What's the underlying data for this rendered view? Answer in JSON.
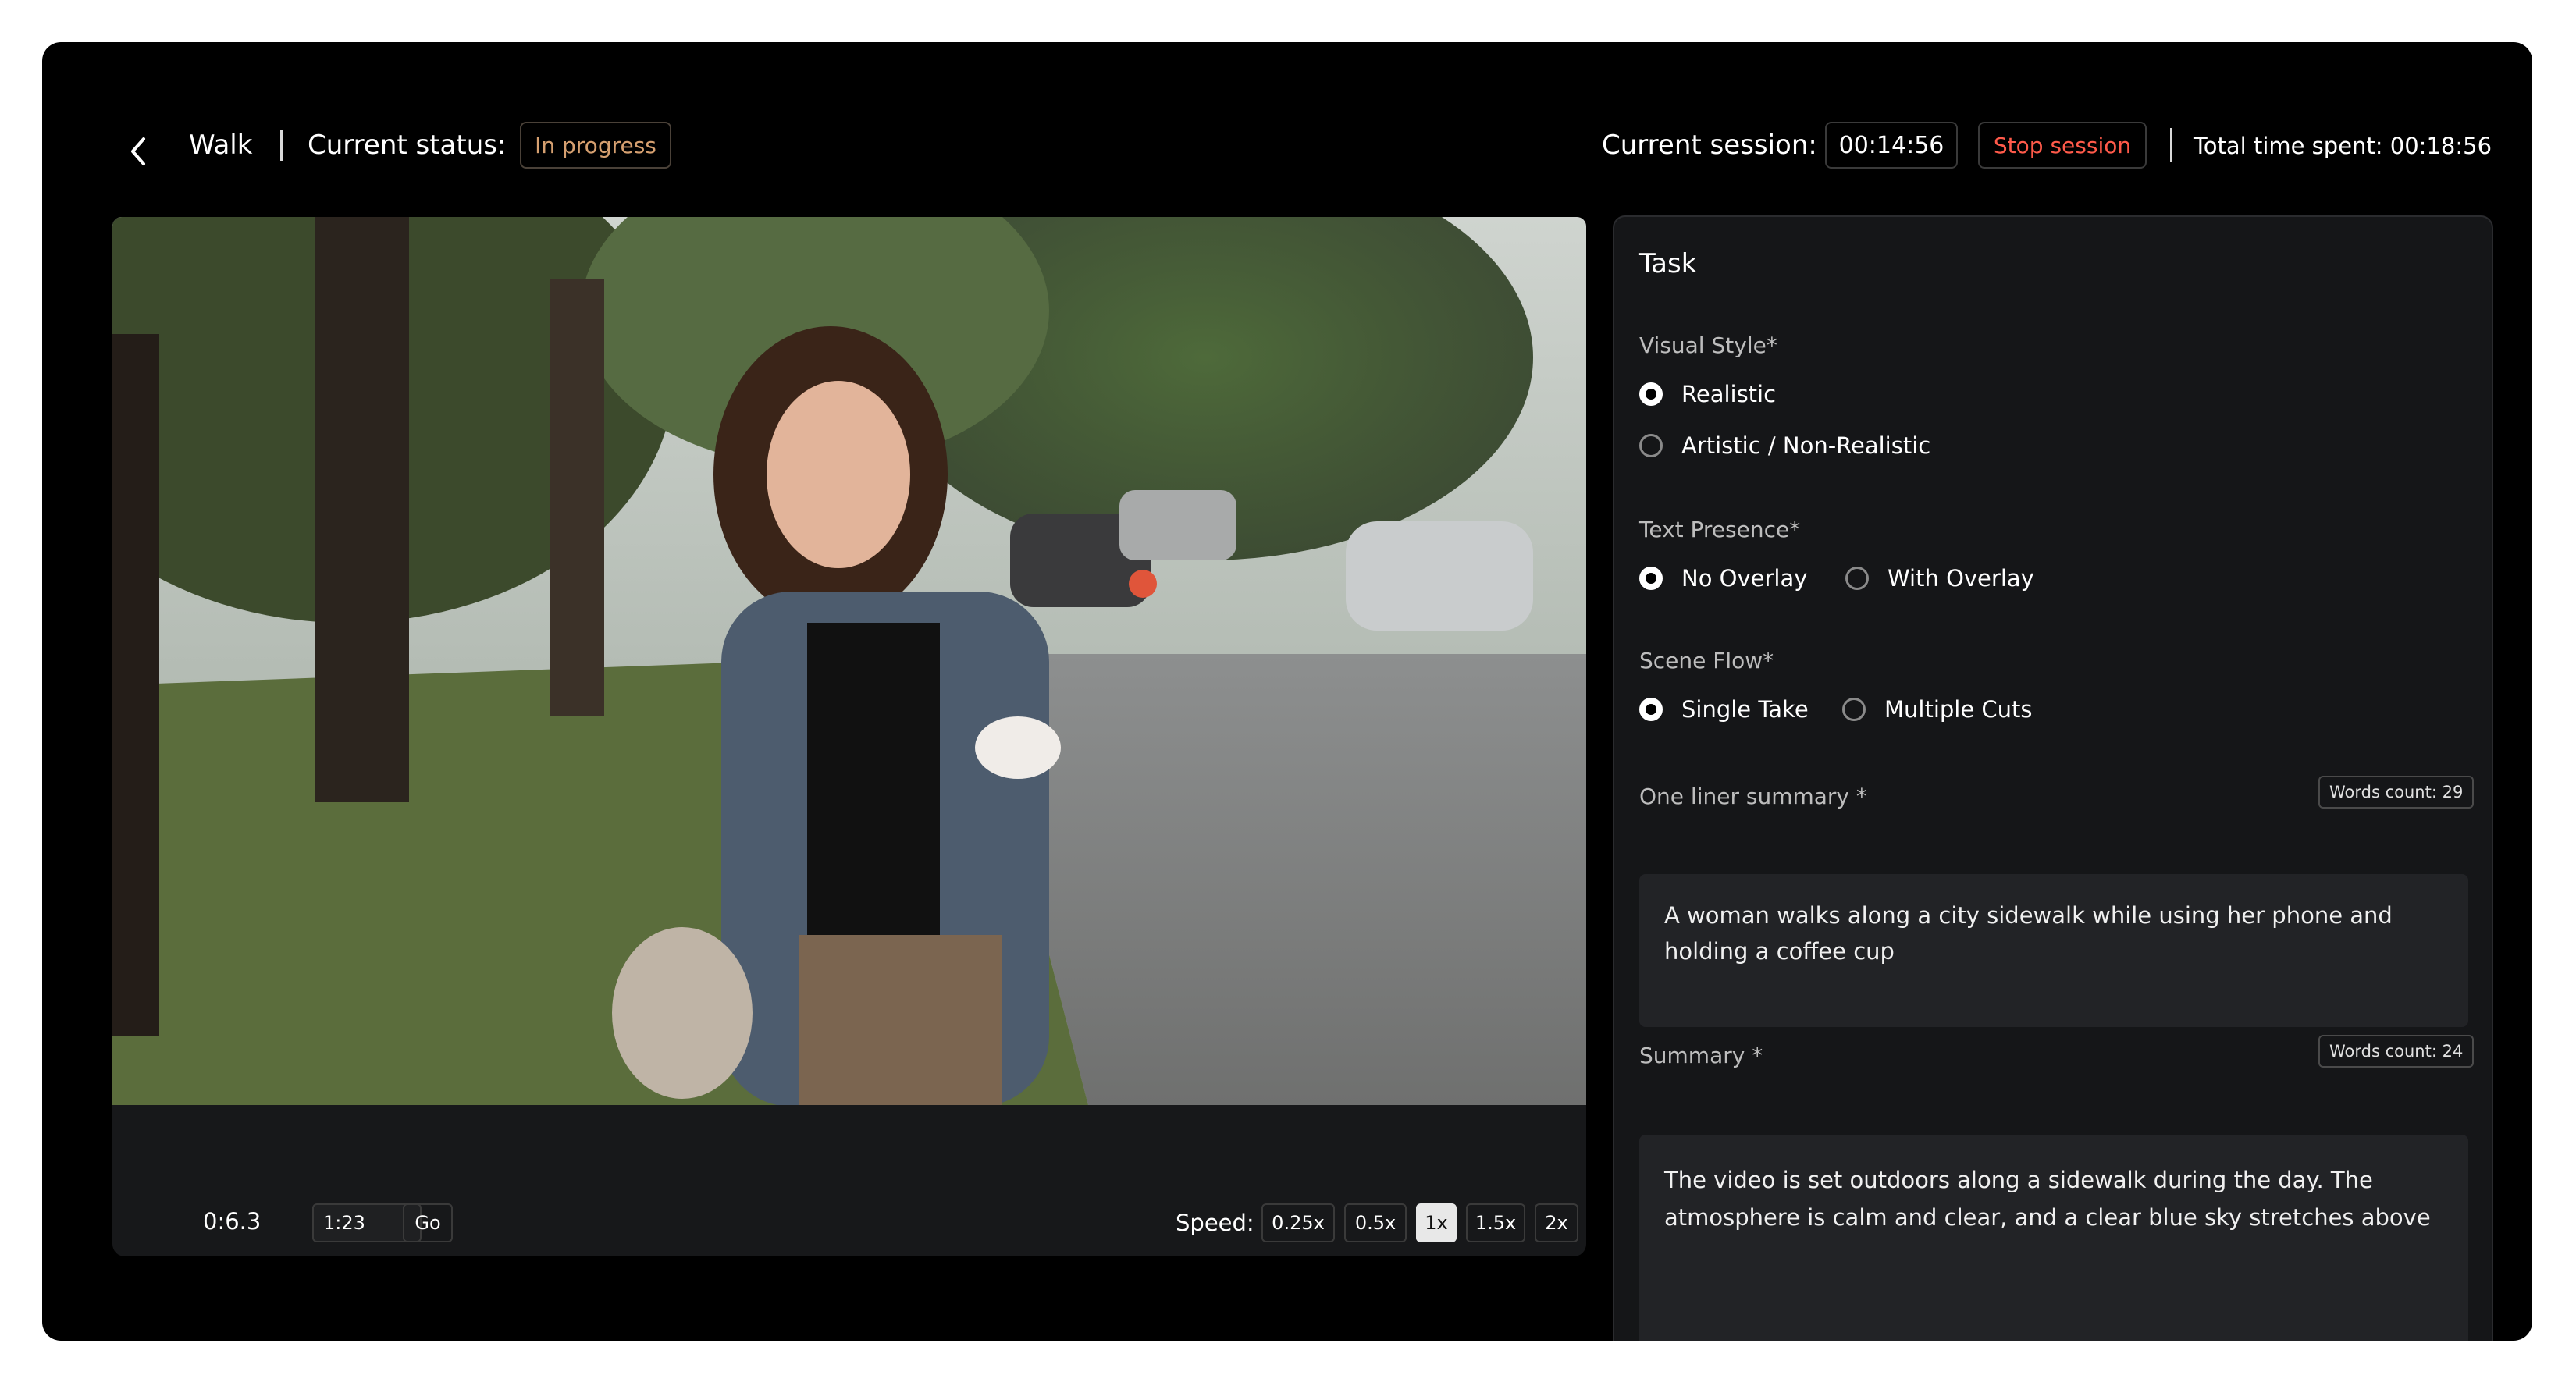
{
  "header": {
    "back_icon": "chevron-left-icon",
    "title": "Walk",
    "status_label": "Current status:",
    "status_value": "In progress",
    "session_label": "Current session:",
    "session_time": "00:14:56",
    "stop_label": "Stop session",
    "total_time": "Total time spent: 00:18:56"
  },
  "player": {
    "current_time": "0:6.3",
    "jump_input": "1:23",
    "go_label": "Go",
    "speed_label": "Speed:",
    "speeds": [
      "0.25x",
      "0.5x",
      "1x",
      "1.5x",
      "2x"
    ],
    "active_speed": "1x"
  },
  "task": {
    "title": "Task",
    "visual_style": {
      "label": "Visual Style*",
      "options": [
        "Realistic",
        "Artistic / Non-Realistic"
      ],
      "selected": "Realistic"
    },
    "text_presence": {
      "label": "Text Presence*",
      "options": [
        "No Overlay",
        "With Overlay"
      ],
      "selected": "No Overlay"
    },
    "scene_flow": {
      "label": "Scene Flow*",
      "options": [
        "Single Take",
        "Multiple Cuts"
      ],
      "selected": "Single Take"
    },
    "one_liner": {
      "label": "One liner summary *",
      "word_count": "Words count: 29",
      "text": "A woman walks along a city sidewalk while using her phone and holding a coffee cup"
    },
    "summary": {
      "label": "Summary *",
      "word_count": "Words count: 24",
      "text": "The video is set outdoors along a sidewalk during the day. The atmosphere is calm and clear, and a clear blue sky stretches above"
    }
  },
  "colors": {
    "status_accent": "#d6a070",
    "stop_accent": "#ff5a4a",
    "background": "#000000",
    "panel": "#151618"
  }
}
